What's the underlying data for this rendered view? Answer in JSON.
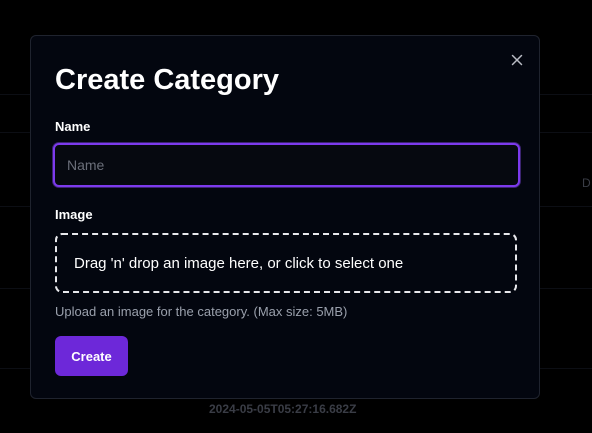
{
  "modal": {
    "title": "Create Category",
    "close_icon": "close-icon",
    "name_label": "Name",
    "name_value": "",
    "name_placeholder": "Name",
    "image_label": "Image",
    "dropzone_text": "Drag 'n' drop an image here, or click to select one",
    "helper_text": "Upload an image for the category. (Max size: 5MB)",
    "create_label": "Create"
  },
  "background": {
    "row_text_right": "D",
    "timestamp": "2024-05-05T05:27:16.682Z"
  },
  "colors": {
    "accent": "#7c3aed",
    "button": "#6d28d9",
    "modal_bg": "#03060f",
    "page_bg": "#000000"
  }
}
